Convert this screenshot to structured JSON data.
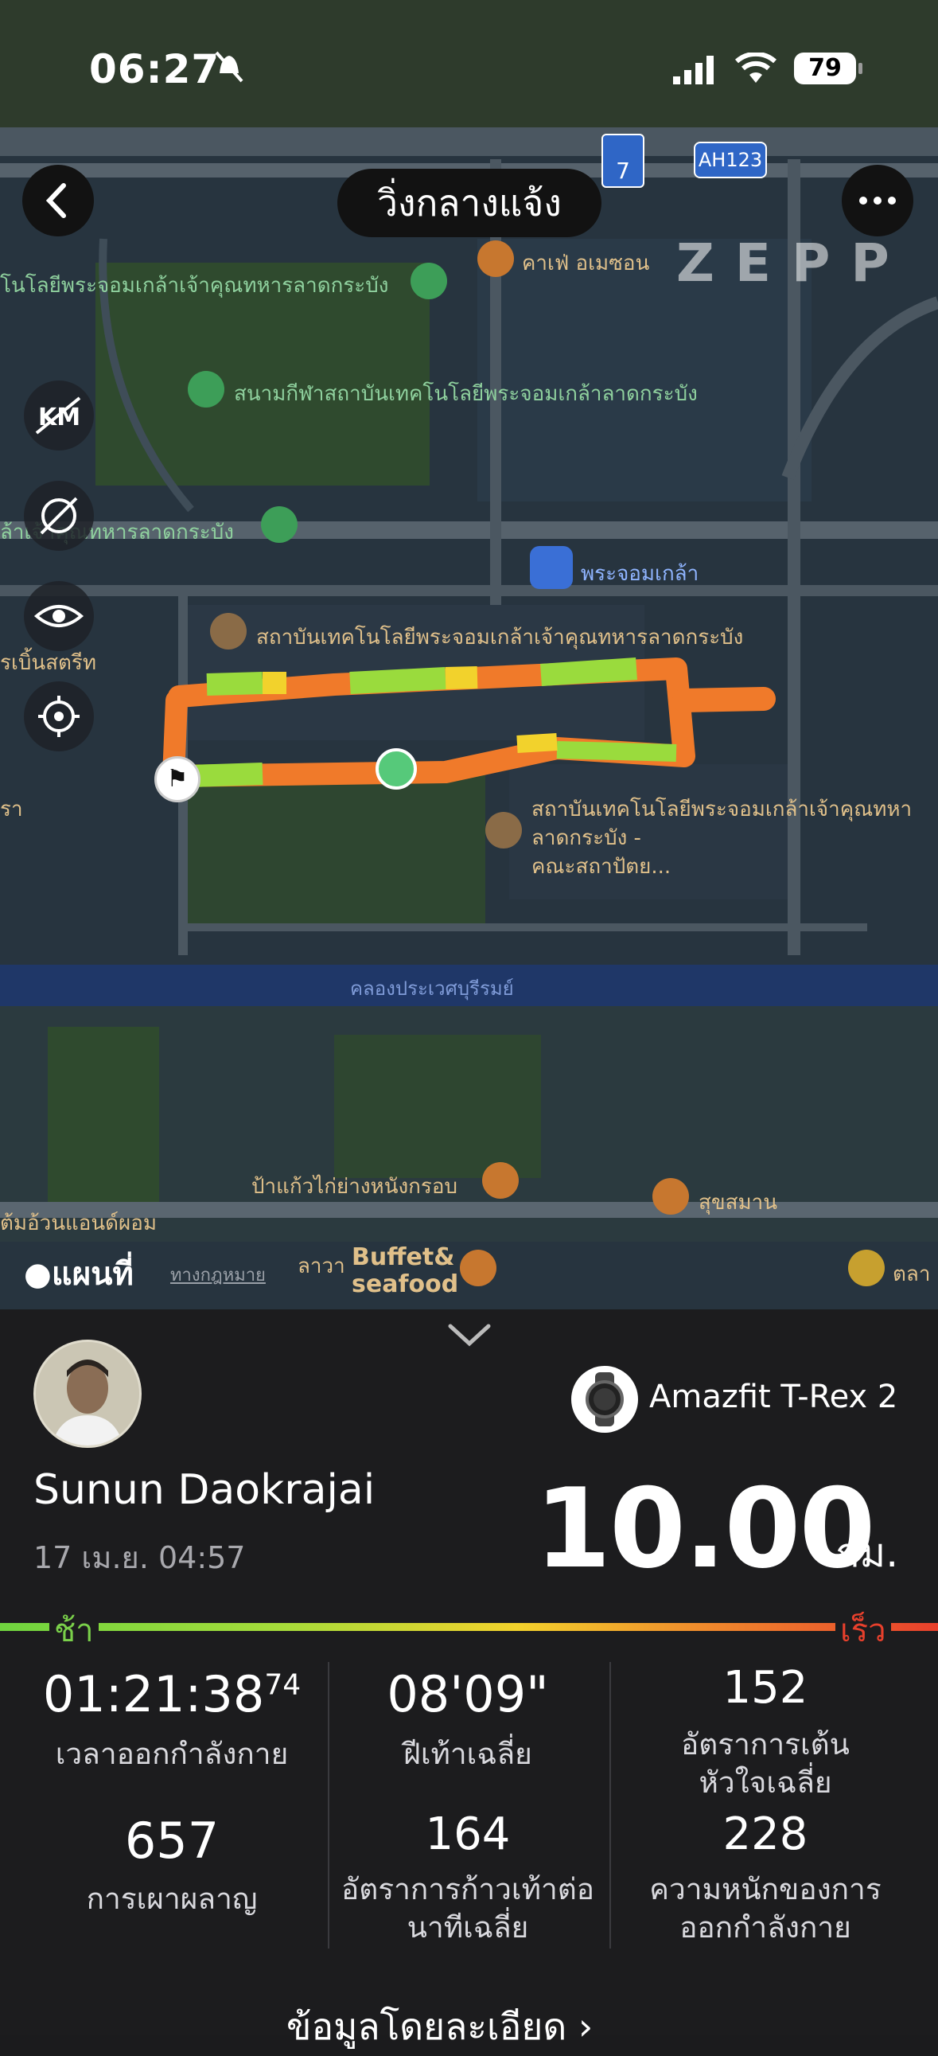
{
  "status_bar": {
    "time": "06:27",
    "battery": "79"
  },
  "header": {
    "title": "วิ่งกลางแจ้ง",
    "brand_watermark": "ZEPP"
  },
  "map": {
    "labels": {
      "cafe": "คาเฟ่ อเมซอน",
      "tech_top": "โนโลยีพระจอมเกล้าเจ้าคุณทหารลาดกระบัง",
      "stadium": "สนามกีฬาสถาบันเทคโนโลยีพระจอมเกล้าลาดกระบัง",
      "military_left": "ล้าเจ้าคุณทหารลาดกระบัง",
      "station": "พระจอมเกล้า",
      "institute": "สถาบันเทคโนโลยีพระจอมเกล้าเจ้าคุณทหารลาดกระบัง",
      "left_street": "รเบิ้นสตรีท",
      "faculty_line1": "สถาบันเทคโนโลยีพระจอมเกล้าเจ้าคุณทหา",
      "faculty_line2": "ลาดกระบัง -",
      "faculty_line3": "คณะสถาปัตย...",
      "canal": "คลองประเวศบุรีรมย์",
      "chicken": "ป้าแก้วไก่ย่างหนังกรอบ",
      "liquor": "สุขสมาน",
      "left_food": "ต้มอ้วนแอนด์ผอม",
      "buffet_prefix": "ลาวา",
      "buffet": "Buffet&",
      "buffet2": "seafood",
      "market": "ตลา",
      "left_edge": "รา",
      "highway_shield": "7",
      "ah_route": "AH123"
    },
    "attribution": {
      "brand": "แผนที่",
      "legal": "ทางกฎหมาย"
    }
  },
  "workout": {
    "user_name": "Sunun Daokrajai",
    "date": "17 เม.ย. 04:57",
    "device": "Amazfit T-Rex 2",
    "distance": "10.00",
    "distance_unit": "กม.",
    "pace_legend": {
      "slow": "ช้า",
      "fast": "เร็ว"
    },
    "stats": [
      {
        "value": "01:21:38",
        "value_sup": "74",
        "label": "เวลาออกกำลังกาย"
      },
      {
        "value": "08'09\"",
        "label": "ฝีเท้าเฉลี่ย"
      },
      {
        "value": "152",
        "label_line1": "อัตราการเต้น",
        "label_line2": "หัวใจเฉลี่ย"
      },
      {
        "value": "657",
        "label": "การเผาผลาญ"
      },
      {
        "value": "164",
        "label_line1": "อัตราการก้าวเท้าต่อ",
        "label_line2": "นาทีเฉลี่ย"
      },
      {
        "value": "228",
        "label_line1": "ความหนักของการ",
        "label_line2": "ออกกำลังกาย"
      }
    ],
    "details_link": "ข้อมูลโดยละเอียด"
  },
  "colors": {
    "slow": "#6fd43f",
    "mid": "#f2d22c",
    "fast": "#e8402c",
    "route_orange": "#f07a2a"
  }
}
